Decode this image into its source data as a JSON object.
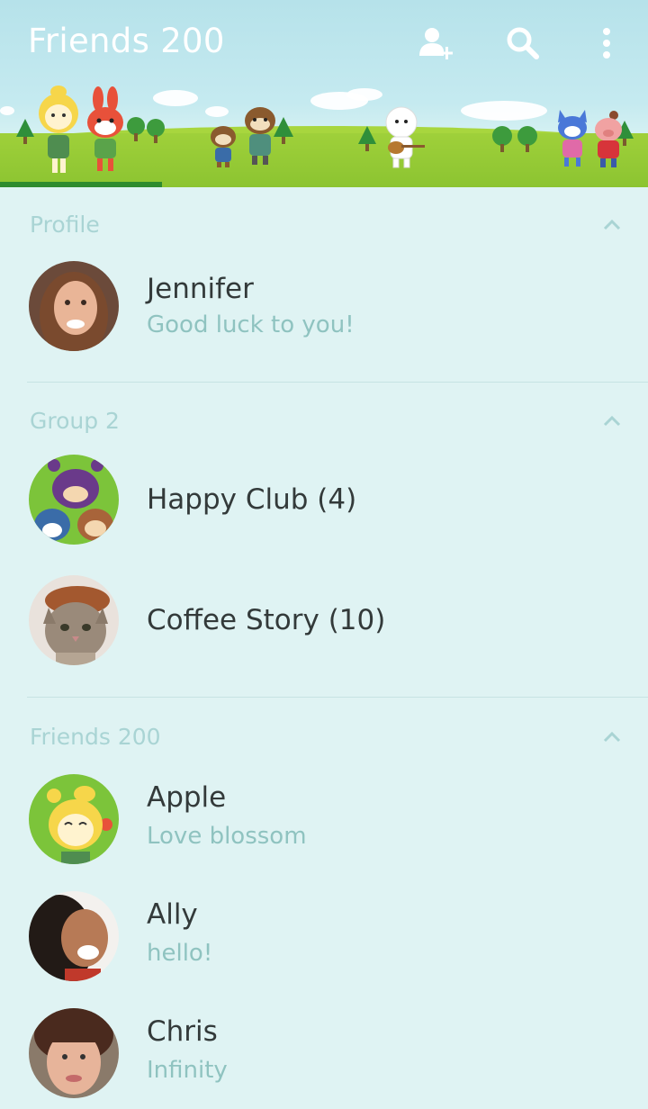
{
  "header": {
    "title": "Friends 200",
    "add_friend_icon": "add-person-icon",
    "search_icon": "search-icon",
    "menu_icon": "more-vertical-icon",
    "progress": 0.25,
    "colors": {
      "sky": "#b6e2ea",
      "grass": "#9fd03a",
      "progress": "#2e8b2e"
    }
  },
  "sections": {
    "profile": {
      "title": "Profile",
      "items": [
        {
          "name": "Jennifer",
          "status": "Good luck to you!"
        }
      ]
    },
    "groups": {
      "title": "Group 2",
      "items": [
        {
          "name": "Happy Club (4)"
        },
        {
          "name": "Coffee Story (10)"
        }
      ]
    },
    "friends": {
      "title": "Friends 200",
      "items": [
        {
          "name": "Apple",
          "status": "Love blossom"
        },
        {
          "name": "Ally",
          "status": "hello!"
        },
        {
          "name": "Chris",
          "status": "Infinity"
        }
      ]
    }
  },
  "colors": {
    "background": "#dff3f3",
    "section_title": "#a9d4d4",
    "name_text": "#333a3a",
    "status_text": "#8fc3c0"
  }
}
